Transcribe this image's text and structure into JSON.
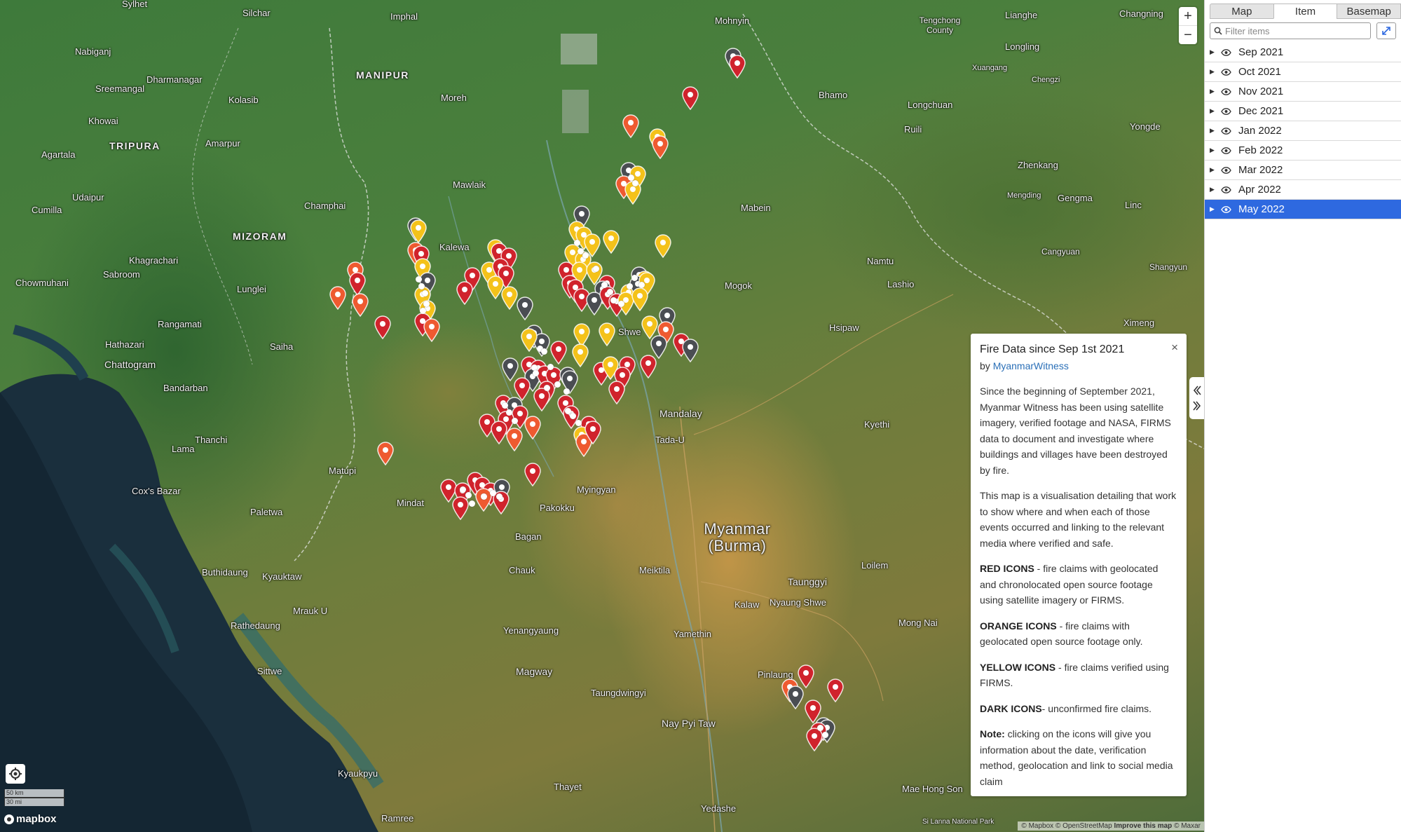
{
  "map": {
    "places": {
      "sylhet": "Sylhet",
      "silchar": "Silchar",
      "imphal": "Imphal",
      "manipur": "MANIPUR",
      "nabigonj": "Nabiganj",
      "dharmanagar": "Dharmanagar",
      "sreemangal": "Sreemangal",
      "khowai": "Khowai",
      "tripura": "TRIPURA",
      "kolasib": "Kolasib",
      "agartala": "Agartala",
      "amarpur": "Amarpur",
      "udaipur": "Udaipur",
      "cumilla": "Cumilla",
      "mizoram": "MIZORAM",
      "champhai": "Champhai",
      "khagrachari": "Khagrachari",
      "sabroom": "Sabroom",
      "chowmuhani": "Chowmuhani",
      "lunglei": "Lunglei",
      "rangamati": "Rangamati",
      "hathazari": "Hathazari",
      "saiha": "Saiha",
      "chattogram": "Chattogram",
      "bandarban": "Bandarban",
      "lama": "Lama",
      "thanchi": "Thanchi",
      "matupi": "Matupi",
      "coxs": "Cox's Bazar",
      "paletwa": "Paletwa",
      "buthidaung": "Buthidaung",
      "kyauktaw": "Kyauktaw",
      "mrauk": "Mrauk U",
      "rathedaung": "Rathedaung",
      "sittwe": "Sittwe",
      "kyaukpyu": "Kyaukpyu",
      "ramree": "Ramree",
      "moreh": "Moreh",
      "mawlaik": "Mawlaik",
      "kalewa": "Kalewa",
      "mindat": "Mindat",
      "pakokku": "Pakokku",
      "bagan": "Bagan",
      "chauk": "Chauk",
      "yenangyaung": "Yenangyaung",
      "magway": "Magway",
      "taungdwingyi": "Taungdwingyi",
      "thayet": "Thayet",
      "mohnyin": "Mohnyin",
      "bhamo": "Bhamo",
      "mabein": "Mabein",
      "mogok": "Mogok",
      "shwebo": "Shwe",
      "mandalay": "Mandalay",
      "tada": "Tada-U",
      "myingyan": "Myingyan",
      "meiktila": "Meiktila",
      "yamethin": "Yamethin",
      "naypyitaw": "Nay Pyi Taw",
      "yedashe": "Yedashe",
      "myanmar": "Myanmar (Burma)",
      "namtu": "Namtu",
      "lashio": "Lashio",
      "hsipaw": "Hsipaw",
      "kyethi": "Kyethi",
      "loilem": "Loilem",
      "taunggyi": "Taunggyi",
      "kalaw": "Kalaw",
      "nyaung": "Nyaung Shwe",
      "pinlaung": "Pinlaung",
      "monghsat": "Mong Nai",
      "maehong": "Mae Hong Son",
      "silanna": "Si Lanna National Park",
      "tengchong": "Tengchong County",
      "lianghe": "Lianghe",
      "changning": "Changning",
      "longling": "Longling",
      "xuangang": "Xuangang",
      "chengzi": "Chengzi",
      "longchuan": "Longchuan",
      "ruili": "Ruili",
      "zhenkang": "Zhenkang",
      "yongde": "Yongde",
      "mengding": "Mengding",
      "gengma": "Gengma",
      "cangyuan": "Cangyuan",
      "shangyun": "Shangyun",
      "ximeng": "Ximeng",
      "lincang": "Linc"
    },
    "zoom_in": "+",
    "zoom_out": "−",
    "scale_km": "50 km",
    "scale_mi": "30 mi",
    "logo": "mapbox",
    "attribution": {
      "mapbox": "© Mapbox",
      "osm": "© OpenStreetMap",
      "improve": "Improve this map",
      "maxar": "© Maxar"
    }
  },
  "info": {
    "title": "Fire Data since Sep 1st 2021",
    "by_prefix": "by ",
    "by_link": "MyanmarWitness",
    "close": "×",
    "p1": "Since the beginning of September 2021, Myanmar Witness has been using satellite imagery, verified footage and NASA, FIRMS data to document and investigate where buildings and villages have been destroyed by fire.",
    "p2": "This map is a visualisation detailing that work to show where and when each of those events occurred and linking to the relevant media where verified and safe.",
    "red_label": "RED ICONS",
    "red_text": " - fire claims with geolocated and chronolocated open source footage using satellite imagery or FIRMS.",
    "orange_label": "ORANGE ICONS",
    "orange_text": " - fire claims with geolocated open source footage only.",
    "yellow_label": "YELLOW ICONS",
    "yellow_text": " - fire claims verified using FIRMS.",
    "dark_label": "DARK ICONS",
    "dark_text": "- unconfirmed fire claims.",
    "note_label": "Note:",
    "note_text": " clicking on the icons will give you information about the date, verification method, geolocation and link to social media claim"
  },
  "panel": {
    "tabs": [
      "Map",
      "Item",
      "Basemap"
    ],
    "active_tab": "Item",
    "filter_placeholder": "Filter items",
    "items": [
      {
        "label": "Sep 2021",
        "selected": false
      },
      {
        "label": "Oct 2021",
        "selected": false
      },
      {
        "label": "Nov 2021",
        "selected": false
      },
      {
        "label": "Dec 2021",
        "selected": false
      },
      {
        "label": "Jan 2022",
        "selected": false
      },
      {
        "label": "Feb 2022",
        "selected": false
      },
      {
        "label": "Mar 2022",
        "selected": false
      },
      {
        "label": "Apr 2022",
        "selected": false
      },
      {
        "label": "May 2022",
        "selected": true
      }
    ]
  },
  "colors": {
    "red": "#d0232c",
    "orange": "#ee5a30",
    "yellow": "#f4c21a",
    "dark": "#4a4d52",
    "selection": "#2e69e0",
    "link": "#2a6fb7"
  },
  "icons": [
    "plus-icon",
    "minus-icon",
    "geolocate-icon",
    "search-icon",
    "expand-icon",
    "eye-icon",
    "caret-right-icon",
    "chevron-left-icon",
    "chevron-right-icon",
    "map-pin-icon",
    "close-icon"
  ]
}
